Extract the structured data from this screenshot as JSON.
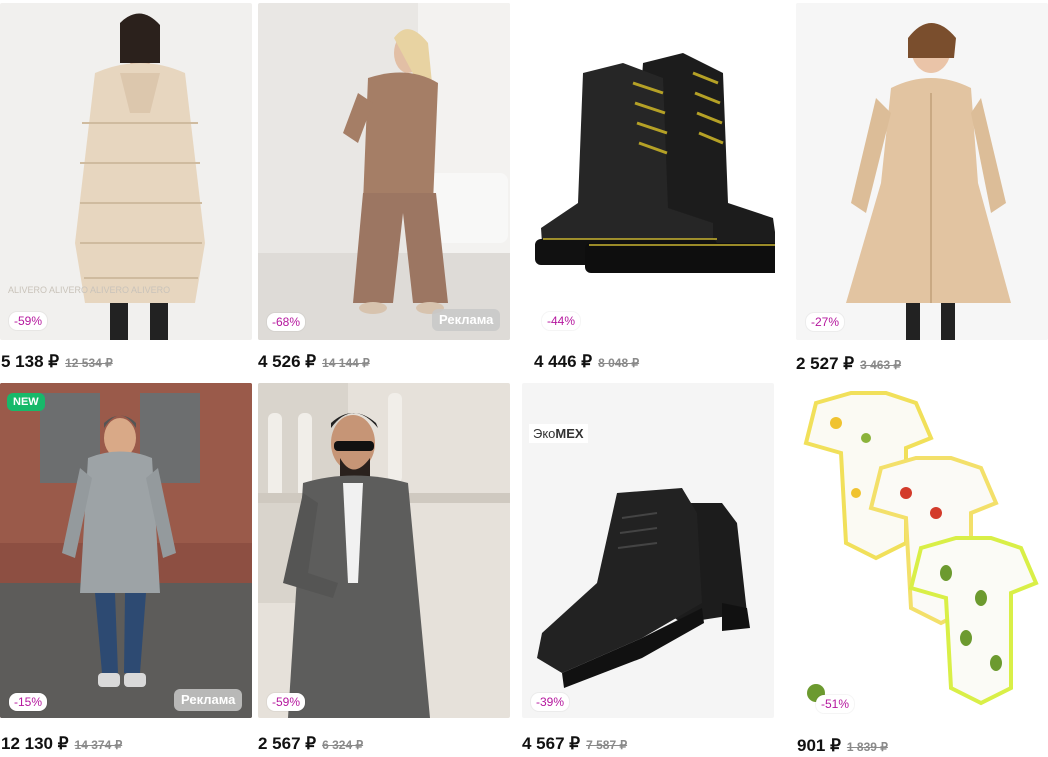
{
  "products": [
    {
      "price": "5 138 ₽",
      "old_price": "12 534 ₽",
      "discount": "-59%"
    },
    {
      "price": "4 526 ₽",
      "old_price": "14 144 ₽",
      "discount": "-68%",
      "ad": "Реклама"
    },
    {
      "price": "4 446 ₽",
      "old_price": "8 048 ₽",
      "discount": "-44%"
    },
    {
      "price": "2 527 ₽",
      "old_price": "3 463 ₽",
      "discount": "-27%"
    },
    {
      "price": "12 130 ₽",
      "old_price": "14 374 ₽",
      "discount": "-15%",
      "ad": "Реклама",
      "badge": "NEW"
    },
    {
      "price": "2 567 ₽",
      "old_price": "6 324 ₽",
      "discount": "-59%"
    },
    {
      "price": "4 567 ₽",
      "old_price": "7 587 ₽",
      "discount": "-39%",
      "brand_prefix": "Эко",
      "brand_suffix": "MEX"
    },
    {
      "price": "901 ₽",
      "old_price": "1 839 ₽",
      "discount": "-51%"
    }
  ],
  "colors": {
    "discount_text": "#b5179e",
    "new_badge": "#17b96a",
    "ad_badge": "#c8c8c8"
  }
}
